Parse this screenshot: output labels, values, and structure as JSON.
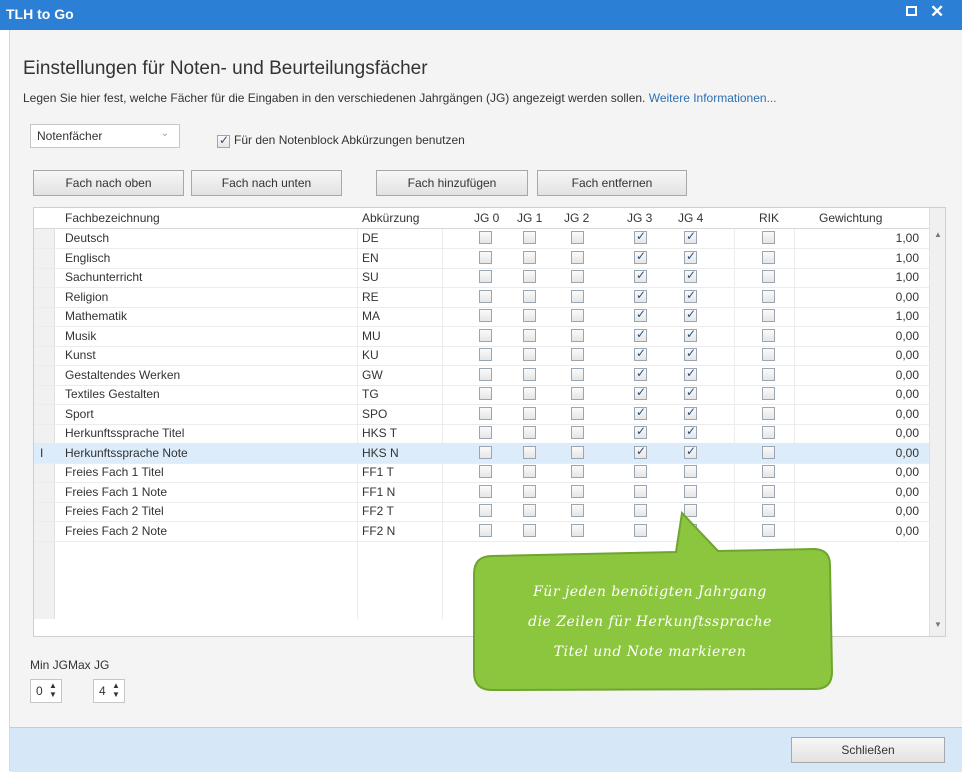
{
  "window": {
    "title": "TLH to Go",
    "maximize_glyph": "",
    "close_glyph": "✕"
  },
  "heading": "Einstellungen für Noten- und Beurteilungsfächer",
  "description": {
    "text": "Legen Sie hier fest, welche Fächer für die Eingaben in den verschiedenen Jahrgängen (JG) angezeigt werden sollen. ",
    "link": "Weitere Informationen..."
  },
  "subject_type": {
    "selected": "Notenfächer"
  },
  "abbreviation_option": {
    "label": "Für den Notenblock Abkürzungen benutzen",
    "checked": true
  },
  "buttons": {
    "move_up": "Fach nach oben",
    "move_down": "Fach nach unten",
    "add": "Fach hinzufügen",
    "remove": "Fach entfernen"
  },
  "grid": {
    "columns": [
      "Fachbezeichnung",
      "Abkürzung",
      "JG 0",
      "JG 1",
      "JG 2",
      "JG 3",
      "JG 4",
      "RIK",
      "Gewichtung"
    ],
    "rows": [
      {
        "name": "Deutsch",
        "abbr": "DE",
        "jg": [
          false,
          false,
          false,
          true,
          true
        ],
        "rik": false,
        "weight": "1,00"
      },
      {
        "name": "Englisch",
        "abbr": "EN",
        "jg": [
          false,
          false,
          false,
          true,
          true
        ],
        "rik": false,
        "weight": "1,00"
      },
      {
        "name": "Sachunterricht",
        "abbr": "SU",
        "jg": [
          false,
          false,
          false,
          true,
          true
        ],
        "rik": false,
        "weight": "1,00"
      },
      {
        "name": "Religion",
        "abbr": "RE",
        "jg": [
          false,
          false,
          false,
          true,
          true
        ],
        "rik": false,
        "weight": "0,00"
      },
      {
        "name": "Mathematik",
        "abbr": "MA",
        "jg": [
          false,
          false,
          false,
          true,
          true
        ],
        "rik": false,
        "weight": "1,00"
      },
      {
        "name": "Musik",
        "abbr": "MU",
        "jg": [
          false,
          false,
          false,
          true,
          true
        ],
        "rik": false,
        "weight": "0,00"
      },
      {
        "name": "Kunst",
        "abbr": "KU",
        "jg": [
          false,
          false,
          false,
          true,
          true
        ],
        "rik": false,
        "weight": "0,00"
      },
      {
        "name": "Gestaltendes Werken",
        "abbr": "GW",
        "jg": [
          false,
          false,
          false,
          true,
          true
        ],
        "rik": false,
        "weight": "0,00"
      },
      {
        "name": "Textiles Gestalten",
        "abbr": "TG",
        "jg": [
          false,
          false,
          false,
          true,
          true
        ],
        "rik": false,
        "weight": "0,00"
      },
      {
        "name": "Sport",
        "abbr": "SPO",
        "jg": [
          false,
          false,
          false,
          true,
          true
        ],
        "rik": false,
        "weight": "0,00"
      },
      {
        "name": "Herkunftssprache Titel",
        "abbr": "HKS T",
        "jg": [
          false,
          false,
          false,
          true,
          true
        ],
        "rik": false,
        "weight": "0,00"
      },
      {
        "name": "Herkunftssprache Note",
        "abbr": "HKS N",
        "jg": [
          false,
          false,
          false,
          true,
          true
        ],
        "rik": false,
        "weight": "0,00",
        "selected": true,
        "marker": "I"
      },
      {
        "name": "Freies Fach 1 Titel",
        "abbr": "FF1 T",
        "jg": [
          false,
          false,
          false,
          false,
          false
        ],
        "rik": false,
        "weight": "0,00"
      },
      {
        "name": "Freies Fach 1 Note",
        "abbr": "FF1 N",
        "jg": [
          false,
          false,
          false,
          false,
          false
        ],
        "rik": false,
        "weight": "0,00"
      },
      {
        "name": "Freies Fach 2 Titel",
        "abbr": "FF2 T",
        "jg": [
          false,
          false,
          false,
          false,
          false
        ],
        "rik": false,
        "weight": "0,00"
      },
      {
        "name": "Freies Fach 2 Note",
        "abbr": "FF2 N",
        "jg": [
          false,
          false,
          false,
          false,
          false
        ],
        "rik": false,
        "weight": "0,00"
      }
    ]
  },
  "year_range": {
    "min_label": "Min JG",
    "max_label": "Max JG",
    "min_value": "0",
    "max_value": "4"
  },
  "close_button": "Schließen",
  "callout": {
    "line1": "Für jeden benötigten Jahrgang",
    "line2": "die Zeilen für  Herkunftssprache",
    "line3": "Titel und Note markieren",
    "color": "#8cc63f"
  },
  "colors": {
    "titlebar": "#2b7fd4",
    "link": "#2d6fb5",
    "selected_row": "#dcecfb",
    "footer": "#d6e7f8"
  }
}
